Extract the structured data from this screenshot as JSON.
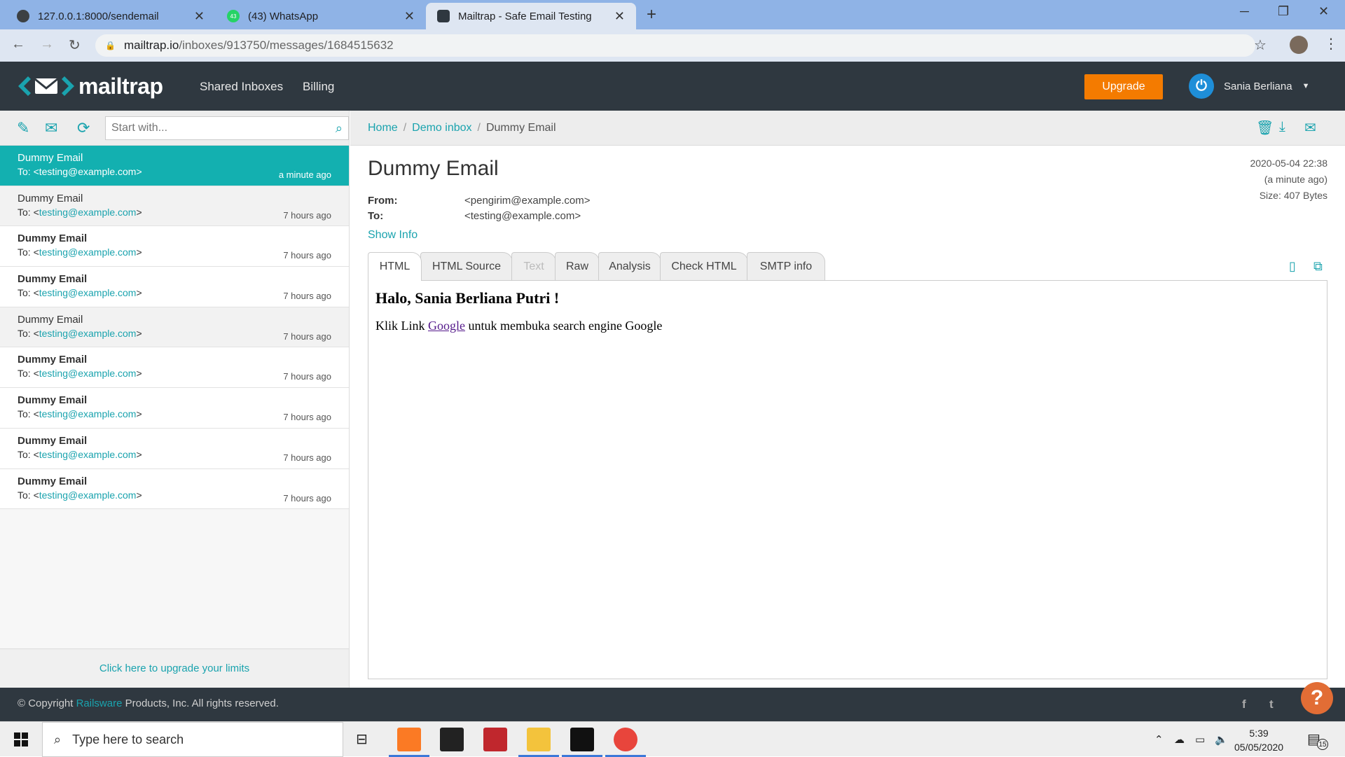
{
  "browser": {
    "tabs": [
      {
        "title": "127.0.0.1:8000/sendemail",
        "close": "✕"
      },
      {
        "title": "(43) WhatsApp",
        "close": "✕",
        "badge": "43"
      },
      {
        "title": "Mailtrap - Safe Email Testing",
        "close": "✕"
      }
    ],
    "new_tab": "+",
    "url_host": "mailtrap.io",
    "url_path": "/inboxes/913750/messages/1684515632"
  },
  "header": {
    "logo": "mailtrap",
    "nav": [
      "Shared Inboxes",
      "Billing"
    ],
    "upgrade": "Upgrade",
    "user": "Sania Berliana"
  },
  "sidebar": {
    "search_placeholder": "Start with...",
    "messages": [
      {
        "subject": "Dummy Email",
        "to_prefix": "To: ",
        "to": "<testing@example.com>",
        "time": "a minute ago"
      },
      {
        "subject": "Dummy Email",
        "to_prefix": "To: <",
        "to": "testing@example.com",
        "to_suffix": ">",
        "time": "7 hours ago"
      },
      {
        "subject": "Dummy Email",
        "to_prefix": "To: <",
        "to": "testing@example.com",
        "to_suffix": ">",
        "time": "7 hours ago"
      },
      {
        "subject": "Dummy Email",
        "to_prefix": "To: <",
        "to": "testing@example.com",
        "to_suffix": ">",
        "time": "7 hours ago"
      },
      {
        "subject": "Dummy Email",
        "to_prefix": "To: <",
        "to": "testing@example.com",
        "to_suffix": ">",
        "time": "7 hours ago"
      },
      {
        "subject": "Dummy Email",
        "to_prefix": "To: <",
        "to": "testing@example.com",
        "to_suffix": ">",
        "time": "7 hours ago"
      },
      {
        "subject": "Dummy Email",
        "to_prefix": "To: <",
        "to": "testing@example.com",
        "to_suffix": ">",
        "time": "7 hours ago"
      },
      {
        "subject": "Dummy Email",
        "to_prefix": "To: <",
        "to": "testing@example.com",
        "to_suffix": ">",
        "time": "7 hours ago"
      },
      {
        "subject": "Dummy Email",
        "to_prefix": "To: <",
        "to": "testing@example.com",
        "to_suffix": ">",
        "time": "7 hours ago"
      }
    ],
    "upgrade_limits": "Click here to upgrade your limits"
  },
  "breadcrumb": {
    "home": "Home",
    "inbox": "Demo inbox",
    "current": "Dummy Email",
    "sep": "/"
  },
  "message": {
    "subject": "Dummy Email",
    "datetime": "2020-05-04 22:38",
    "relative": "(a minute ago)",
    "size": "Size: 407 Bytes",
    "from_label": "From:",
    "from": "<pengirim@example.com>",
    "to_label": "To:",
    "to": "<testing@example.com>",
    "show_info": "Show Info",
    "tabs": [
      "HTML",
      "HTML Source",
      "Text",
      "Raw",
      "Analysis",
      "Check HTML",
      "SMTP info"
    ],
    "body_heading": "Halo, Sania Berliana Putri !",
    "body_before": "Klik Link ",
    "body_link": "Google",
    "body_after": " untuk membuka search engine Google"
  },
  "footer": {
    "copy_before": "© Copyright ",
    "company": "Railsware",
    "copy_after": " Products, Inc. All rights reserved.",
    "help": "?"
  },
  "taskbar": {
    "search": "Type here to search",
    "time": "5:39",
    "date": "05/05/2020",
    "notifications": "15"
  },
  "colors": {
    "accent": "#1aa3ae",
    "selected": "#13b0b0",
    "upgrade": "#f47b00",
    "header_bg": "#2f3840"
  }
}
